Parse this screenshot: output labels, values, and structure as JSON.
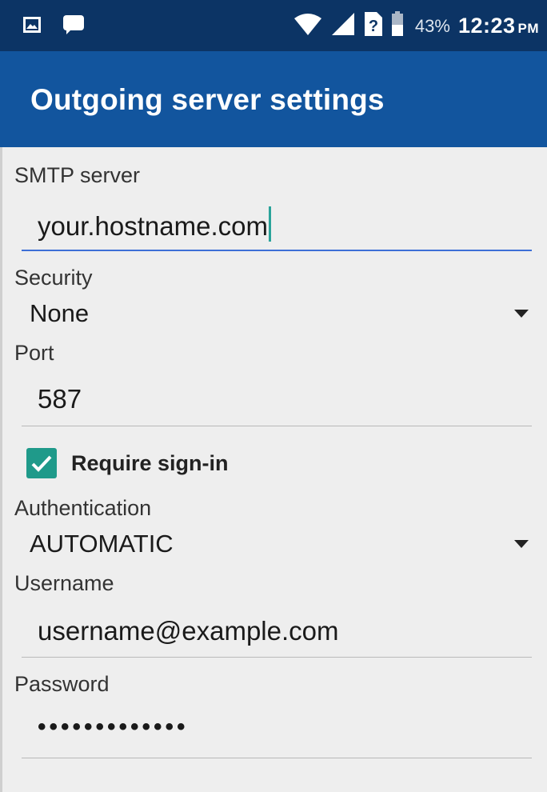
{
  "status_bar": {
    "battery_percent": "43%",
    "time": "12:23",
    "ampm": "PM",
    "icons": [
      "image-notification-icon",
      "message-notification-icon",
      "wifi-icon",
      "signal-icon",
      "no-sim-icon",
      "battery-icon"
    ]
  },
  "app_bar": {
    "title": "Outgoing server settings"
  },
  "form": {
    "smtp_server": {
      "label": "SMTP server",
      "value": "your.hostname.com"
    },
    "security": {
      "label": "Security",
      "value": "None"
    },
    "port": {
      "label": "Port",
      "value": "587"
    },
    "require_signin": {
      "label": "Require sign-in",
      "checked": true
    },
    "authentication": {
      "label": "Authentication",
      "value": "AUTOMATIC"
    },
    "username": {
      "label": "Username",
      "value": "username@example.com"
    },
    "password": {
      "label": "Password",
      "value": "•••••••••••••"
    }
  },
  "colors": {
    "status_bar": "#0c3465",
    "app_bar": "#12559e",
    "background": "#eeeeee",
    "accent_underline": "#3d6fd6",
    "checkbox": "#1f9a8a",
    "cursor": "#2aa39a"
  }
}
